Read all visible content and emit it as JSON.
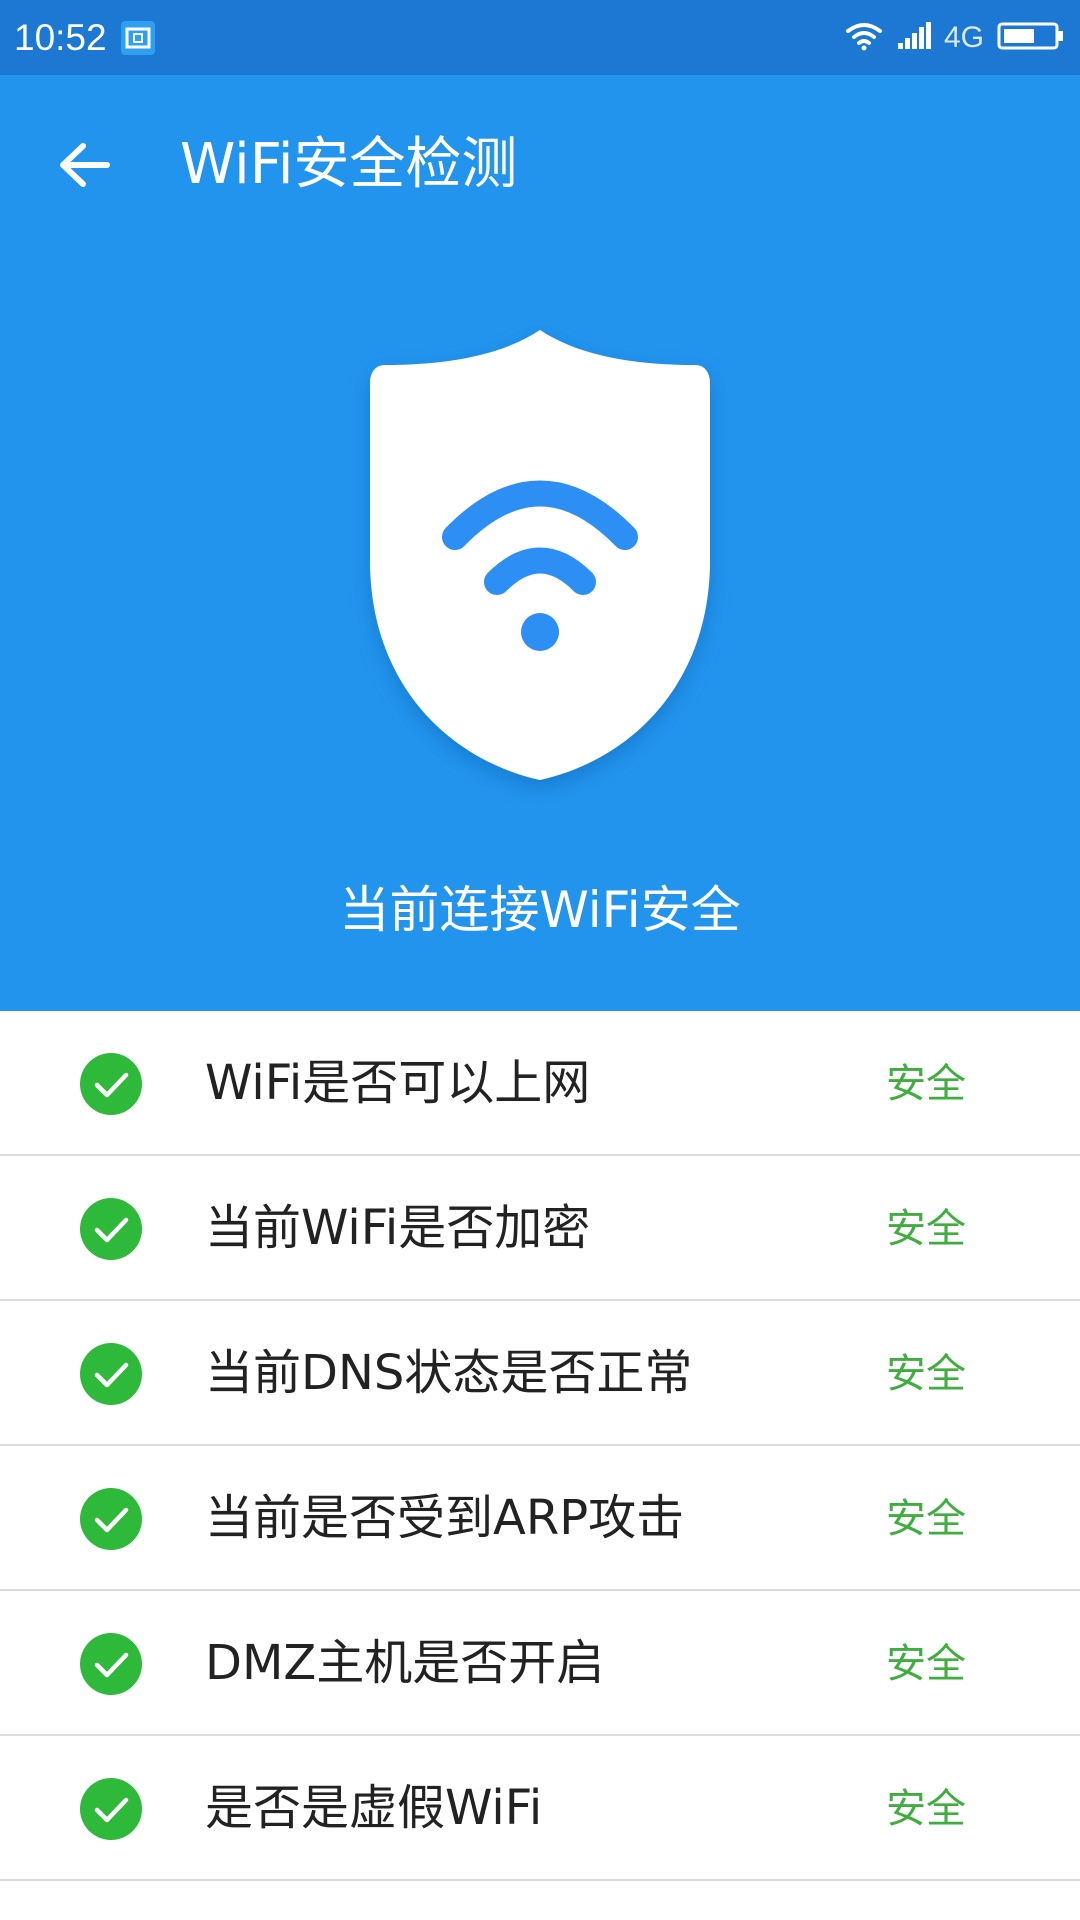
{
  "status_bar": {
    "time": "10:52",
    "network": "4G",
    "icons": [
      "screenshot-icon",
      "wifi-icon",
      "signal-icon",
      "battery-icon"
    ]
  },
  "header": {
    "title": "WiFi安全检测",
    "status_message": "当前连接WiFi安全",
    "background_color": "#2294ee"
  },
  "checks": [
    {
      "label": "WiFi是否可以上网",
      "result": "安全"
    },
    {
      "label": "当前WiFi是否加密",
      "result": "安全"
    },
    {
      "label": "当前DNS状态是否正常",
      "result": "安全"
    },
    {
      "label": "当前是否受到ARP攻击",
      "result": "安全"
    },
    {
      "label": "DMZ主机是否开启",
      "result": "安全"
    },
    {
      "label": "是否是虚假WiFi",
      "result": "安全"
    }
  ],
  "colors": {
    "safe": "#3fae3f",
    "check": "#2fb93a"
  }
}
